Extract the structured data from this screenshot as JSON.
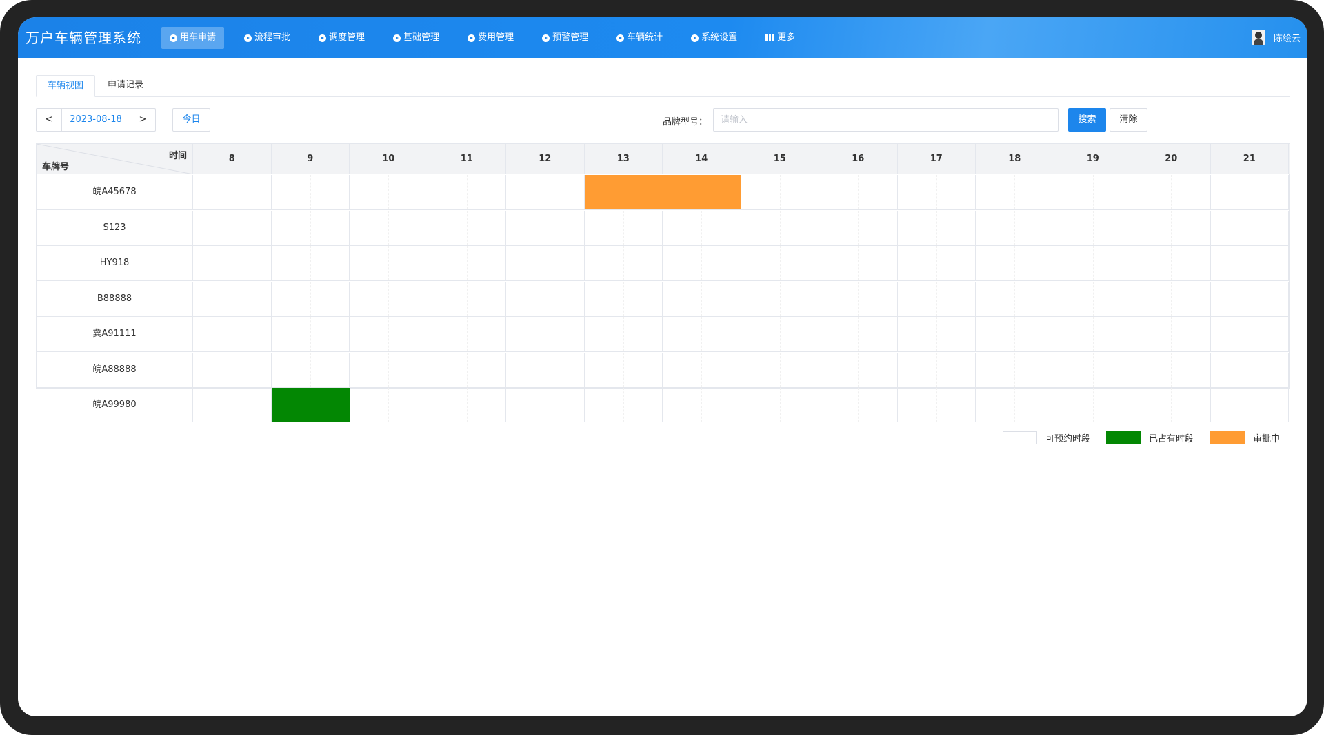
{
  "app": {
    "title": "万户车辆管理系统"
  },
  "nav": [
    {
      "label": "用车申请",
      "active": true,
      "icon": "circle-arrow-icon"
    },
    {
      "label": "流程审批",
      "icon": "circle-arrow-icon"
    },
    {
      "label": "调度管理",
      "icon": "circle-arrow-icon"
    },
    {
      "label": "基础管理",
      "icon": "circle-arrow-icon"
    },
    {
      "label": "费用管理",
      "icon": "circle-arrow-icon"
    },
    {
      "label": "预警管理",
      "icon": "circle-arrow-icon"
    },
    {
      "label": "车辆统计",
      "icon": "circle-arrow-icon"
    },
    {
      "label": "系统设置",
      "icon": "circle-arrow-icon"
    },
    {
      "label": "更多",
      "icon": "grid-icon"
    }
  ],
  "user": {
    "name": "陈绘云"
  },
  "tabs": {
    "vehicle_view": "车辆视图",
    "records": "申请记录"
  },
  "toolbar": {
    "prev": "<",
    "date": "2023-08-18",
    "next": ">",
    "today": "今日",
    "brand_label": "品牌型号：",
    "brand_placeholder": "请输入",
    "search": "搜索",
    "clear": "清除"
  },
  "schedule": {
    "corner_time": "时间",
    "corner_plate": "车牌号",
    "hours": [
      "8",
      "9",
      "10",
      "11",
      "12",
      "13",
      "14",
      "15",
      "16",
      "17",
      "18",
      "19",
      "20",
      "21"
    ],
    "vehicles": [
      {
        "plate": "皖A45678",
        "bookings": [
          {
            "start": 13.0,
            "end": 15.0,
            "status": "pending"
          }
        ]
      },
      {
        "plate": "S123",
        "bookings": []
      },
      {
        "plate": "HY918",
        "bookings": []
      },
      {
        "plate": "B88888",
        "bookings": []
      },
      {
        "plate": "冀A91111",
        "bookings": []
      },
      {
        "plate": "皖A88888",
        "bookings": []
      },
      {
        "plate": "皖A99980",
        "bookings": [
          {
            "start": 9.0,
            "end": 10.0,
            "status": "occupied"
          }
        ]
      }
    ]
  },
  "legend": {
    "free": "可预约时段",
    "occupied": "已占有时段",
    "pending": "审批中"
  },
  "colors": {
    "accent": "#1d86ec",
    "occupied": "#038703",
    "pending": "#ff9c33"
  }
}
